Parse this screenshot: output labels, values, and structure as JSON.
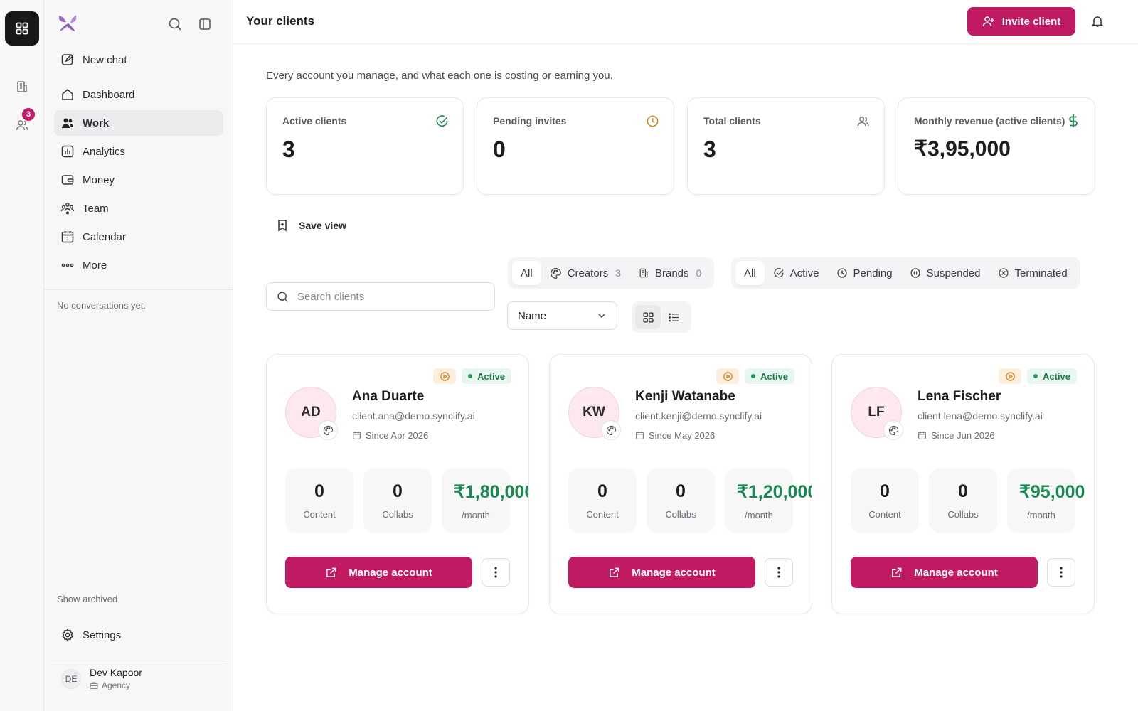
{
  "rail": {
    "badge_count": "3"
  },
  "sidebar": {
    "new_chat": "New chat",
    "items": [
      {
        "label": "Dashboard"
      },
      {
        "label": "Work"
      },
      {
        "label": "Analytics"
      },
      {
        "label": "Money"
      },
      {
        "label": "Team"
      },
      {
        "label": "Calendar"
      },
      {
        "label": "More"
      }
    ],
    "no_conversations": "No conversations yet.",
    "show_archived": "Show archived",
    "settings": "Settings",
    "user": {
      "initials": "DE",
      "name": "Dev Kapoor",
      "role": "Agency"
    }
  },
  "header": {
    "title": "Your clients",
    "invite_label": "Invite client"
  },
  "subtitle": "Every account you manage, and what each one is costing or earning you.",
  "stats": [
    {
      "label": "Active clients",
      "value": "3",
      "icon": "check-circle-icon"
    },
    {
      "label": "Pending invites",
      "value": "0",
      "icon": "clock-icon"
    },
    {
      "label": "Total clients",
      "value": "3",
      "icon": "users-icon"
    },
    {
      "label": "Monthly revenue (active clients)",
      "value": "₹3,95,000",
      "icon": "dollar-icon"
    }
  ],
  "save_view": "Save view",
  "type_filter": {
    "all": "All",
    "creators": {
      "label": "Creators",
      "count": "3"
    },
    "brands": {
      "label": "Brands",
      "count": "0"
    }
  },
  "status_filter": {
    "all": "All",
    "active": "Active",
    "pending": "Pending",
    "suspended": "Suspended",
    "terminated": "Terminated"
  },
  "search": {
    "placeholder": "Search clients"
  },
  "sort": {
    "selected": "Name"
  },
  "clients": [
    {
      "initials": "AD",
      "name": "Ana Duarte",
      "email": "client.ana@demo.synclify.ai",
      "since": "Since Apr 2026",
      "status": "Active",
      "content": "0",
      "content_label": "Content",
      "collabs": "0",
      "collabs_label": "Collabs",
      "revenue": "₹1,80,000",
      "revenue_label": "/month",
      "manage_label": "Manage account"
    },
    {
      "initials": "KW",
      "name": "Kenji Watanabe",
      "email": "client.kenji@demo.synclify.ai",
      "since": "Since May 2026",
      "status": "Active",
      "content": "0",
      "content_label": "Content",
      "collabs": "0",
      "collabs_label": "Collabs",
      "revenue": "₹1,20,000",
      "revenue_label": "/month",
      "manage_label": "Manage account"
    },
    {
      "initials": "LF",
      "name": "Lena Fischer",
      "email": "client.lena@demo.synclify.ai",
      "since": "Since Jun 2026",
      "status": "Active",
      "content": "0",
      "content_label": "Content",
      "collabs": "0",
      "collabs_label": "Collabs",
      "revenue": "₹95,000",
      "revenue_label": "/month",
      "manage_label": "Manage account"
    }
  ],
  "colors": {
    "accent": "#c01a63",
    "success": "#1b8a52",
    "warning": "#c98a2a"
  }
}
